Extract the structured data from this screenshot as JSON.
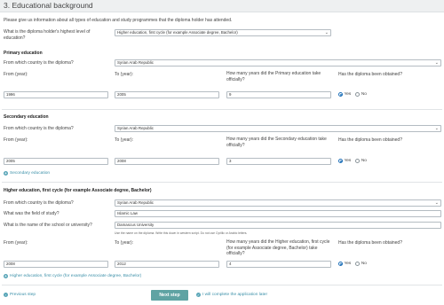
{
  "header": {
    "title": "3. Educational background"
  },
  "intro": "Please give us information about all types of education and study programmes that the diploma holder has attended.",
  "highest_level": {
    "label": "What is the diploma holder's highest level of education?",
    "value": "Higher education, first cycle (for example Associate degree, Bachelor)"
  },
  "primary": {
    "title": "Primary education",
    "country_label": "From which country is the diploma?",
    "country_value": "Syrian Arab Republic",
    "from_label": "From (year):",
    "to_label": "To (year):",
    "years_label": "How many years did the Primary education take officially?",
    "obtained_label": "Has the diploma been obtained?",
    "from_value": "1996",
    "to_value": "2005",
    "years_value": "9",
    "yes": "Yes",
    "no": "No",
    "selected": "yes"
  },
  "secondary": {
    "title": "Secondary education",
    "country_label": "From which country is the diploma?",
    "country_value": "Syrian Arab Republic",
    "from_label": "From (year):",
    "to_label": "To (year):",
    "years_label": "How many years did the Secondary education take officially?",
    "obtained_label": "Has the diploma been obtained?",
    "from_value": "2005",
    "to_value": "2008",
    "years_value": "3",
    "yes": "Yes",
    "no": "No",
    "selected": "yes",
    "add_link": "Secondary education"
  },
  "higher": {
    "title": "Higher education, first cycle (for example Associate degree, Bachelor)",
    "country_label": "From which country is the diploma?",
    "country_value": "Syrian Arab Republic",
    "field_label": "What was the field of study?",
    "field_value": "Islamic Law",
    "school_label": "What is the name of the school or university?",
    "school_value": "Damascus University",
    "school_hint": "Use the name on the diploma. Write this down in western script. Do not use Cyrillic or Arabic letters.",
    "from_label": "From (year):",
    "to_label": "To (year):",
    "years_label": "How many years did the Higher education, first cycle (for example Associate degree, Bachelor) take officially?",
    "obtained_label": "Has the diploma been obtained?",
    "from_value": "2008",
    "to_value": "2012",
    "years_value": "4",
    "yes": "Yes",
    "no": "No",
    "selected": "yes",
    "add_link": "Higher education, first cycle (for example Associate degree, Bachelor)"
  },
  "footer": {
    "prev": "Previous step",
    "next": "Next step",
    "later": "I will complete the application later"
  },
  "colors": {
    "accent": "#5fa3a3",
    "link": "#3a8fa8",
    "radio": "#1d6fb8"
  }
}
